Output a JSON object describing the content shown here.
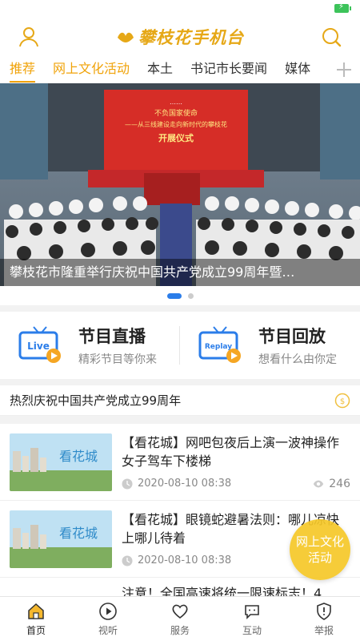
{
  "header": {
    "logo_text": "攀枝花手机台",
    "user_icon": "user-icon",
    "search_icon": "search-icon"
  },
  "tabs": [
    {
      "label": "推荐"
    },
    {
      "label": "网上文化活动"
    },
    {
      "label": "本土"
    },
    {
      "label": "书记市长要闻"
    },
    {
      "label": "媒体"
    }
  ],
  "banner": {
    "caption": "攀枝花市隆重举行庆祝中国共产党成立99周年暨…",
    "stage_line1": "不负国家使命",
    "stage_line2": "——从三线建设走向新时代的攀枝花",
    "stage_line3": "开展仪式"
  },
  "programs": {
    "live": {
      "badge": "Live",
      "title": "节目直播",
      "subtitle": "精彩节目等你来"
    },
    "replay": {
      "badge": "Replay",
      "title": "节目回放",
      "subtitle": "想看什么由你定"
    }
  },
  "notice": {
    "text": "热烈庆祝中国共产党成立99周年"
  },
  "news": [
    {
      "title": "【看花城】网吧包夜后上演一波神操作 女子驾车下楼梯",
      "time": "2020-08-10 08:38",
      "views": "246",
      "thumb_text": "看花城"
    },
    {
      "title": "【看花城】眼镜蛇避暑法则：哪儿凉快上哪儿待着",
      "time": "2020-08-10 08:38",
      "views": "",
      "thumb_text": "看花城"
    }
  ],
  "peek": {
    "title": "注意！全国高速将统一限速标志！4"
  },
  "fab": {
    "label": "网上文化活动"
  },
  "bottom_nav": [
    {
      "label": "首页",
      "icon": "home-icon"
    },
    {
      "label": "视听",
      "icon": "play-icon"
    },
    {
      "label": "服务",
      "icon": "heart-icon"
    },
    {
      "label": "互动",
      "icon": "chat-icon"
    },
    {
      "label": "举报",
      "icon": "shield-icon"
    }
  ],
  "colors": {
    "accent": "#f0a30a",
    "live_blue": "#2b7de9"
  }
}
